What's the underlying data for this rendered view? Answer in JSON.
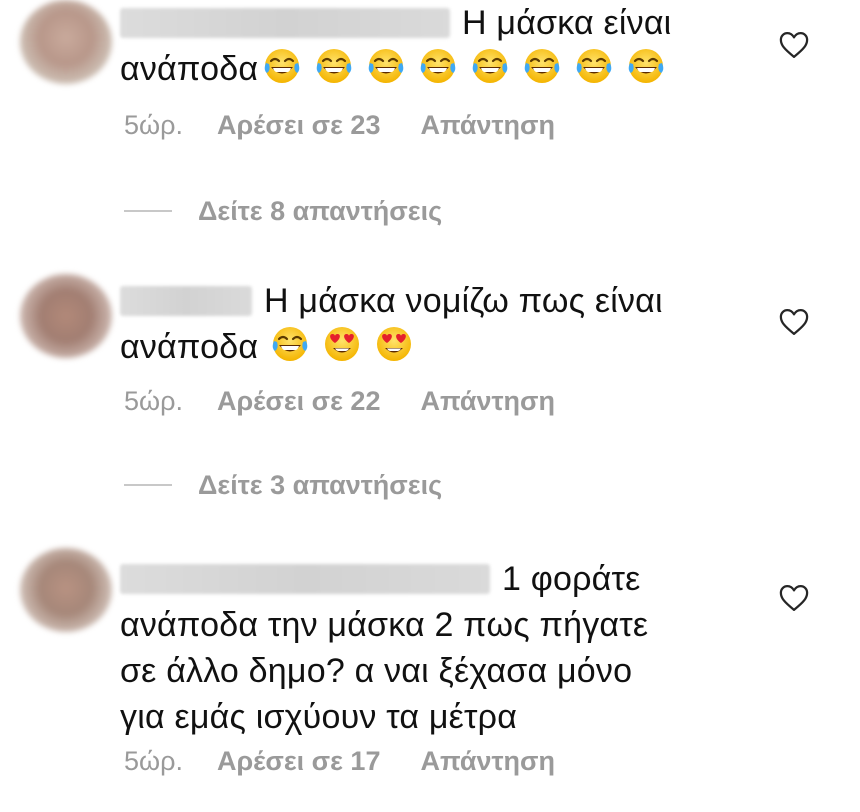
{
  "comments": [
    {
      "text": "Η μάσκα είναι",
      "text_line2": "ανάποδα",
      "emojis": [
        "joy",
        "joy",
        "joy",
        "joy",
        "joy",
        "joy",
        "joy",
        "joy"
      ],
      "time": "5ώρ.",
      "likes": "Αρέσει σε 23",
      "reply": "Απάντηση",
      "view_replies": "Δείτε 8 απαντήσεις"
    },
    {
      "text": "Η μάσκα νομίζω πως είναι",
      "text_line2": "ανάποδα",
      "emojis": [
        "joy",
        "heart-eyes",
        "heart-eyes"
      ],
      "time": "5ώρ.",
      "likes": "Αρέσει σε 22",
      "reply": "Απάντηση",
      "view_replies": "Δείτε 3 απαντήσεις"
    },
    {
      "text": "1 φοράτε",
      "text_line2": "ανάποδα την μάσκα 2 πως πήγατε",
      "text_line3": "σε άλλο δημο? α ναι ξέχασα μόνο",
      "text_line4": "για εμάς ισχύουν τα μέτρα",
      "time": "5ώρ.",
      "likes": "Αρέσει σε 17",
      "reply": "Απάντηση"
    }
  ],
  "icons": {
    "like": "heart-outline-icon",
    "emoji_joy": "face-with-tears-of-joy-emoji",
    "emoji_heart_eyes": "smiling-face-with-heart-eyes-emoji"
  },
  "colors": {
    "text": "#111111",
    "meta": "#9a9a9a",
    "heart_outline": "#262626"
  }
}
